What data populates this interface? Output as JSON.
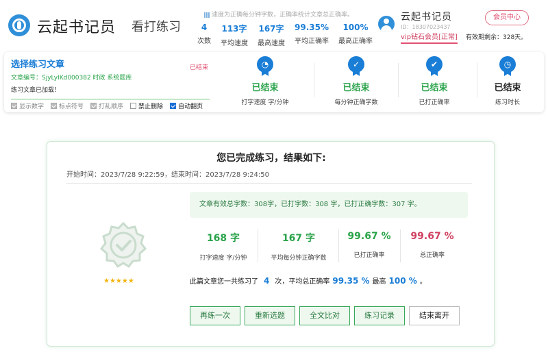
{
  "header": {
    "brand": "云起书记员",
    "mode": "看打练习",
    "note": "速度为正确每分钟字数，正确率统计文章总正确率。",
    "stats": [
      {
        "value": "4",
        "label": "次数"
      },
      {
        "value": "113字",
        "label": "平均速度"
      },
      {
        "value": "167字",
        "label": "最高速度"
      },
      {
        "value": "99.35%",
        "label": "平均正确率"
      },
      {
        "value": "100%",
        "label": "最高正确率"
      }
    ],
    "user": {
      "name": "云起书记员",
      "id": "ID：18307023437",
      "vip": "vip钻石会员[正常]",
      "member_button": "会员中心",
      "expire": "有效期剩余：328天。"
    }
  },
  "panel": {
    "title": "选择练习文章",
    "ended": "已结束",
    "article_code": "文章编号：SjyLyIKd000382  时政  系统题库",
    "loaded": "练习文章已加载！",
    "options": [
      {
        "label": "显示数字",
        "checked": true
      },
      {
        "label": "标点符号",
        "checked": true
      },
      {
        "label": "打乱顺序",
        "checked": true
      },
      {
        "label": "禁止删除",
        "checked": false
      },
      {
        "label": "自动翻页",
        "checked": true
      }
    ],
    "metrics": [
      {
        "value": "已结束",
        "label": "打字速度 字/分钟",
        "icon": "speed-badge-icon"
      },
      {
        "value": "已结束",
        "label": "每分钟正确字数",
        "icon": "check-badge-icon"
      },
      {
        "value": "已结束",
        "label": "已打正确率",
        "icon": "check-badge-icon"
      },
      {
        "value": "已结束",
        "label": "练习时长",
        "icon": "clock-badge-icon"
      }
    ]
  },
  "result": {
    "title": "您已完成练习，结果如下:",
    "time": "开始时间：2023/7/28 9:22:59，结束时间：2023/7/28 9:24:50",
    "summary": "文章有效总字数：308字，已打字数：308 字，已打正确字数：307 字。",
    "rating": "★★★★★",
    "metrics": [
      {
        "value": "168 字",
        "label": "打字速度 字/分钟"
      },
      {
        "value": "167 字",
        "label": "平均每分钟正确字数"
      },
      {
        "value": "99.67 %",
        "label": "已打正确率"
      },
      {
        "value": "99.67 %",
        "label": "总正确率"
      }
    ],
    "practice": {
      "prefix": "此篇文章您一共练习了",
      "count": "4",
      "middle": "次，平均总正确率",
      "avg": "99.35 %",
      "high_label": "最高",
      "high": "100 %",
      "suffix": "。"
    },
    "buttons": [
      "再练一次",
      "重新选题",
      "全文比对",
      "练习记录",
      "结束离开"
    ]
  },
  "colors": {
    "accent_blue": "#1a7dd6",
    "success_green": "#2aa34a",
    "alert_red": "#d04060"
  }
}
